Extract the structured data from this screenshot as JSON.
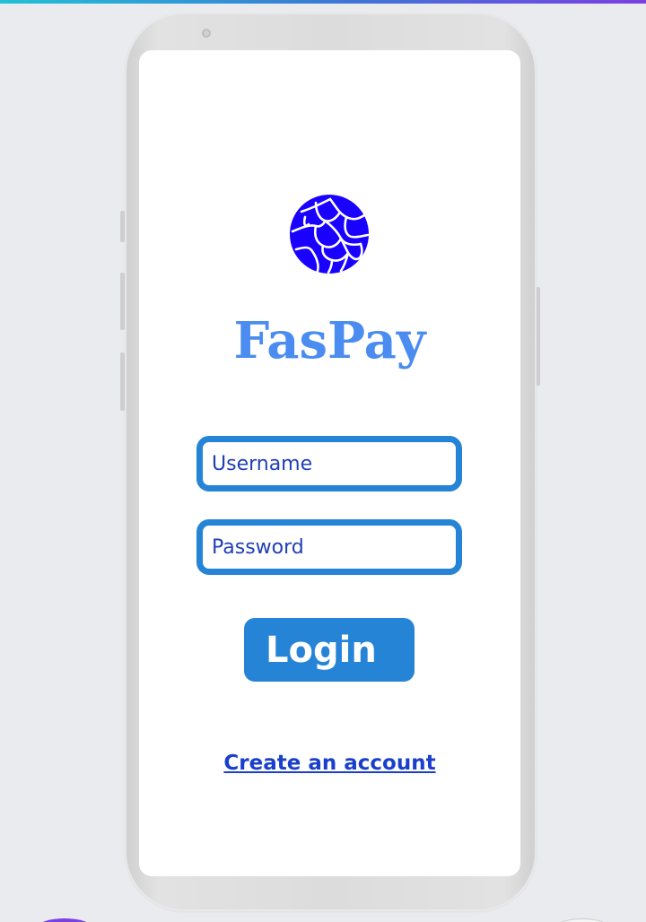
{
  "app": {
    "name": "FasPay",
    "brand_color": "#4a8cf0",
    "accent_color": "#2684d6",
    "logo_icon": "globe-icon",
    "logo_color": "#1a00ff"
  },
  "login_form": {
    "username_placeholder": "Username",
    "password_placeholder": "Password",
    "login_label": "Login",
    "create_account_label": "Create an account"
  }
}
